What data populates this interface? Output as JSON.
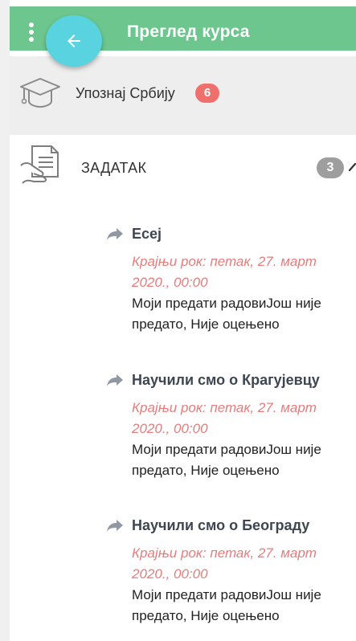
{
  "header": {
    "title": "Преглед курса",
    "menu_icon": "more-vert-icon",
    "back_icon": "arrow-back-icon",
    "accent_color": "#6cc68e",
    "fab_color": "#58d3df"
  },
  "course": {
    "name": "Упознај Србију",
    "badge": "6",
    "icon": "graduation-cap-icon",
    "badge_color": "#ef6f6c"
  },
  "section": {
    "title": "ЗАДАТАК",
    "badge": "3",
    "icon": "assignment-hand-icon",
    "chevron_icon": "chevron-up-icon"
  },
  "assignments": [
    {
      "name": "Есеј",
      "deadline_line1": "Крајњи рок: петак, 27. март",
      "deadline_line2": "2020., 00:00",
      "status_line1": "Моји предати радовиЈош није",
      "status_line2": "предато, Није оцењено"
    },
    {
      "name": "Научили смо о Крагујевцу",
      "deadline_line1": "Крајњи рок: петак, 27. март",
      "deadline_line2": "2020., 00:00",
      "status_line1": "Моји предати радовиЈош није",
      "status_line2": "предато, Није оцењено"
    },
    {
      "name": "Научили смо о Београду",
      "deadline_line1": "Крајњи рок: петак, 27. март",
      "deadline_line2": "2020., 00:00",
      "status_line1": "Моји предати радовиЈош није",
      "status_line2": "предато, Није оцењено"
    }
  ]
}
